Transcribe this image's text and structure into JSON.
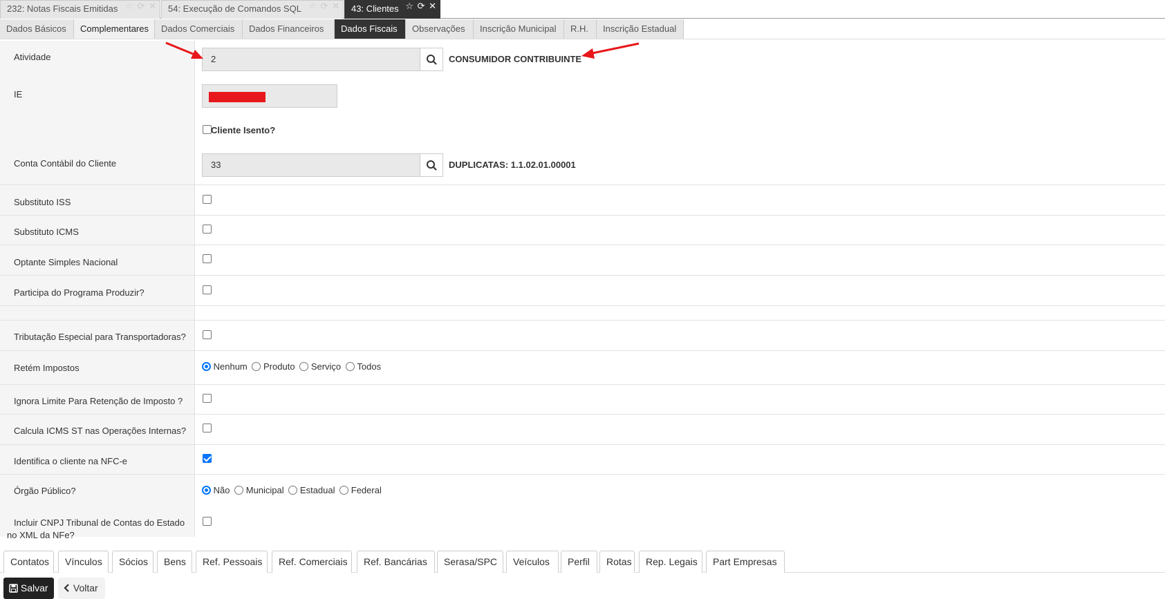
{
  "window_tabs": [
    {
      "label": "232: Notas Fiscais Emitidas",
      "controls": "☆ ⟳ ✕"
    },
    {
      "label": "54: Execução de Comandos SQL",
      "controls": "☆ ⟳ ✕"
    },
    {
      "label": "43: Clientes",
      "controls": "☆ ⟳ ✕"
    }
  ],
  "form_tabs": [
    "Dados Básicos",
    "Complementares",
    "Dados Comerciais",
    "Dados Financeiros",
    "Dados Fiscais",
    "Observações",
    "Inscrição Municipal",
    "R.H.",
    "Inscrição Estadual"
  ],
  "fields": {
    "atividade": {
      "label": "Atividade",
      "value": "2",
      "description": "CONSUMIDOR CONTRIBUINTE"
    },
    "ie": {
      "label": "IE",
      "isento_label": "Cliente Isento?"
    },
    "conta_contabil": {
      "label": "Conta Contábil do Cliente",
      "value": "33",
      "description": "DUPLICATAS: 1.1.02.01.00001"
    },
    "substituto_iss": "Substituto ISS",
    "substituto_icms": "Substituto ICMS",
    "optante_simples": "Optante Simples Nacional",
    "programa_produzir": "Participa do Programa Produzir?",
    "tributacao_transportadoras": "Tributação Especial para Transportadoras?",
    "retem_impostos": {
      "label": "Retém Impostos",
      "options": [
        "Nenhum",
        "Produto",
        "Serviço",
        "Todos"
      ],
      "selected": "Nenhum"
    },
    "ignora_limite": "Ignora Limite Para Retenção de Imposto ?",
    "calcula_icms_st": "Calcula ICMS ST nas Operações Internas?",
    "identifica_nfce": {
      "label": "Identifica o cliente na NFC-e",
      "checked": true
    },
    "orgao_publico": {
      "label": "Órgão Público?",
      "options": [
        "Não",
        "Municipal",
        "Estadual",
        "Federal"
      ],
      "selected": "Não"
    },
    "incluir_cnpj": {
      "line1": "Incluir CNPJ Tribunal de Contas do Estado",
      "line2": "no XML da NFe?"
    }
  },
  "bottom_tabs": [
    "Contatos",
    "Vínculos",
    "Sócios",
    "Bens",
    "Ref. Pessoais",
    "Ref. Comerciais",
    "Ref. Bancárias",
    "Serasa/SPC",
    "Veículos",
    "Perfil",
    "Rotas",
    "Rep. Legais",
    "Part Empresas"
  ],
  "actions": {
    "save": "Salvar",
    "back": "Voltar"
  },
  "colors": {
    "active_tab": "#333333",
    "accent": "#0075ff",
    "annotation_arrow": "#e8171b"
  }
}
